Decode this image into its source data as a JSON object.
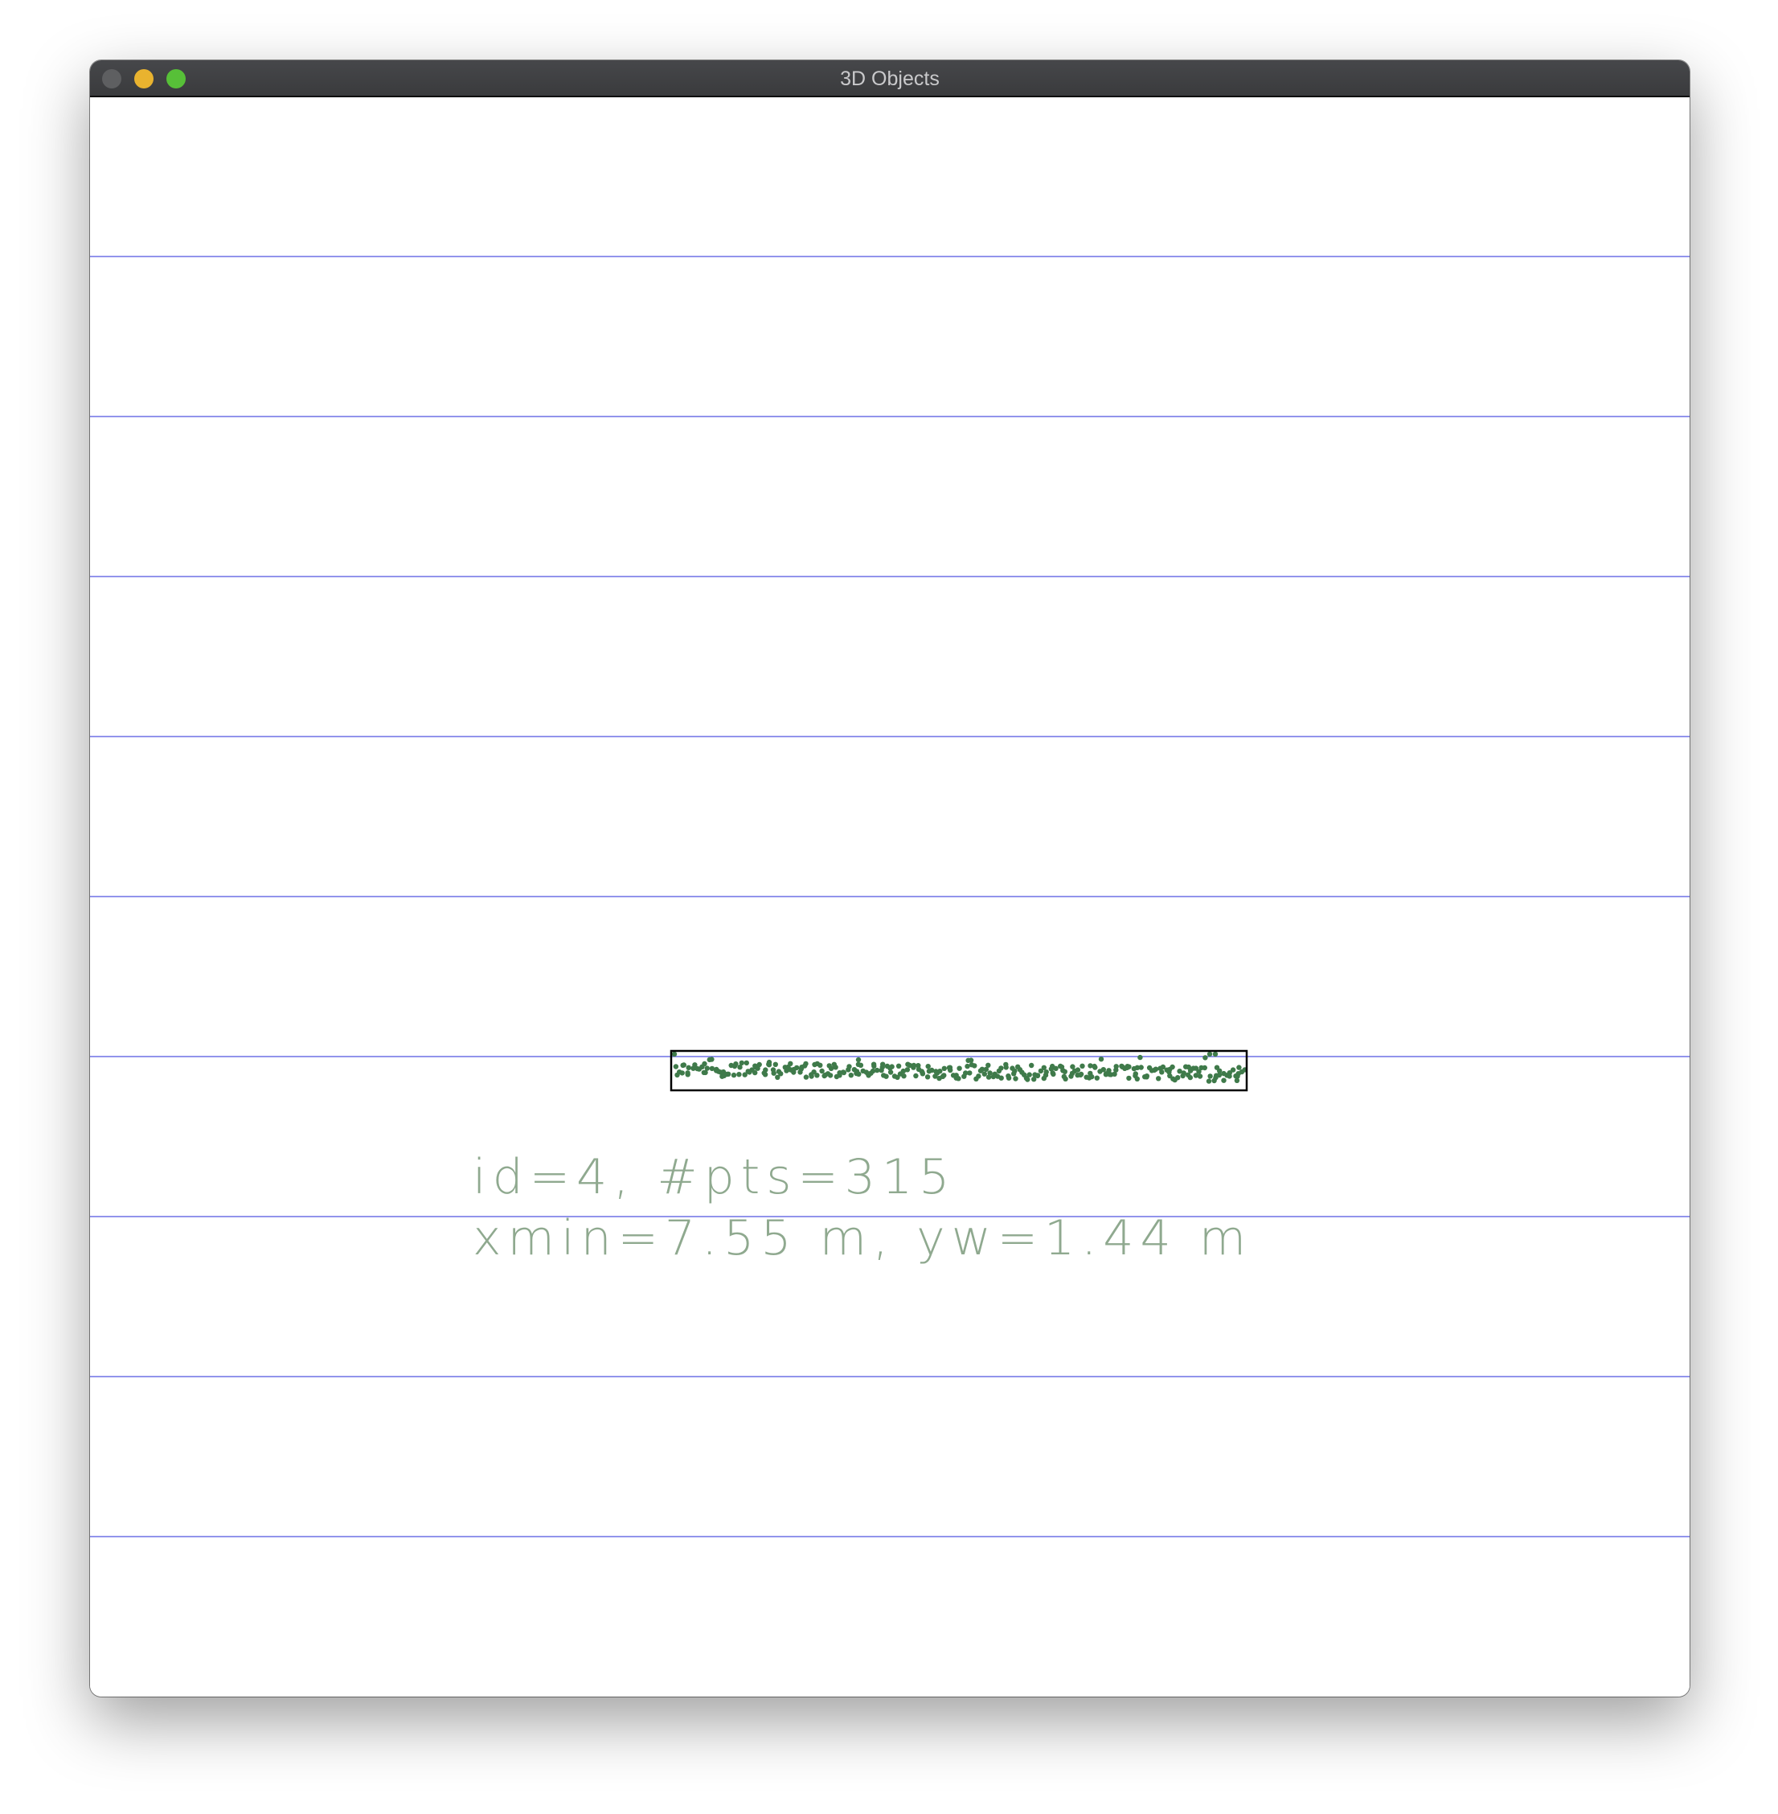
{
  "window": {
    "title": "3D Objects"
  },
  "controls": {
    "close": "close-button",
    "minimize": "minimize-button",
    "zoom": "zoom-button"
  },
  "colors": {
    "grid_line": "#6e70e6",
    "points": "#3f7a4a",
    "box": "#000000",
    "label_text": "#8fa98f"
  },
  "object": {
    "line1": "id=4, #pts=315",
    "line2": "xmin=7.55 m, yw=1.44 m",
    "point_count": 315
  },
  "grid": {
    "line_count": 9
  }
}
